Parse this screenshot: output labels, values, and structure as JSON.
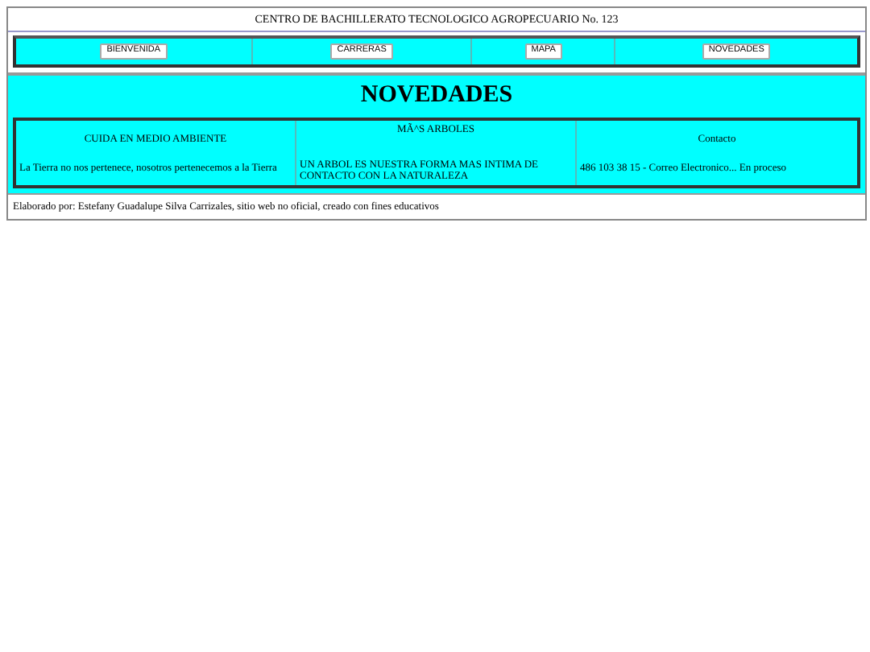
{
  "header": {
    "title": "CENTRO DE BACHILLERATO TECNOLOGICO AGROPECUARIO No. 123"
  },
  "nav": {
    "buttons": [
      "BIENVENIDA",
      "CARRERAS",
      "MAPA",
      "NOVEDADES"
    ]
  },
  "news": {
    "heading": "NOVEDADES",
    "columns": [
      {
        "title": "CUIDA EN MEDIO AMBIENTE",
        "text": "La Tierra no nos pertenece, nosotros pertenecemos a la Tierra"
      },
      {
        "title": "MÃ^S ARBOLES",
        "text": "UN ARBOL ES NUESTRA FORMA MAS INTIMA DE CONTACTO CON LA NATURALEZA"
      },
      {
        "title": "Contacto",
        "text": "486 103 38 15 - Correo Electronico... En proceso"
      }
    ]
  },
  "footer": {
    "text": "Elaborado por: Estefany Guadalupe Silva Carrizales, sitio web no oficial, creado con fines educativos"
  }
}
